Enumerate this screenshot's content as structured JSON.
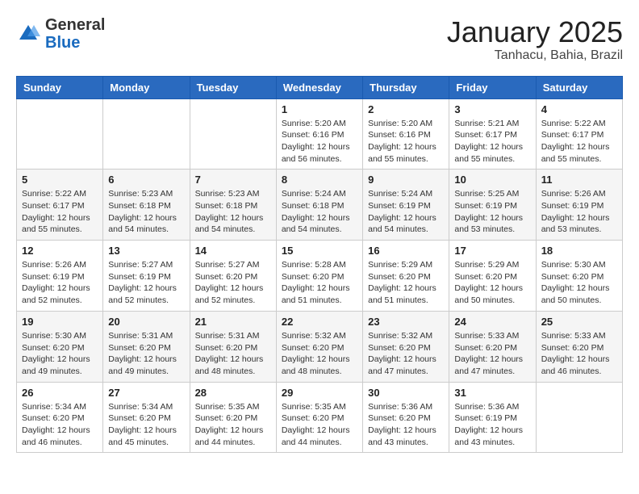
{
  "logo": {
    "general": "General",
    "blue": "Blue"
  },
  "header": {
    "month": "January 2025",
    "location": "Tanhacu, Bahia, Brazil"
  },
  "weekdays": [
    "Sunday",
    "Monday",
    "Tuesday",
    "Wednesday",
    "Thursday",
    "Friday",
    "Saturday"
  ],
  "weeks": [
    [
      {
        "day": "",
        "info": ""
      },
      {
        "day": "",
        "info": ""
      },
      {
        "day": "",
        "info": ""
      },
      {
        "day": "1",
        "info": "Sunrise: 5:20 AM\nSunset: 6:16 PM\nDaylight: 12 hours and 56 minutes."
      },
      {
        "day": "2",
        "info": "Sunrise: 5:20 AM\nSunset: 6:16 PM\nDaylight: 12 hours and 55 minutes."
      },
      {
        "day": "3",
        "info": "Sunrise: 5:21 AM\nSunset: 6:17 PM\nDaylight: 12 hours and 55 minutes."
      },
      {
        "day": "4",
        "info": "Sunrise: 5:22 AM\nSunset: 6:17 PM\nDaylight: 12 hours and 55 minutes."
      }
    ],
    [
      {
        "day": "5",
        "info": "Sunrise: 5:22 AM\nSunset: 6:17 PM\nDaylight: 12 hours and 55 minutes."
      },
      {
        "day": "6",
        "info": "Sunrise: 5:23 AM\nSunset: 6:18 PM\nDaylight: 12 hours and 54 minutes."
      },
      {
        "day": "7",
        "info": "Sunrise: 5:23 AM\nSunset: 6:18 PM\nDaylight: 12 hours and 54 minutes."
      },
      {
        "day": "8",
        "info": "Sunrise: 5:24 AM\nSunset: 6:18 PM\nDaylight: 12 hours and 54 minutes."
      },
      {
        "day": "9",
        "info": "Sunrise: 5:24 AM\nSunset: 6:19 PM\nDaylight: 12 hours and 54 minutes."
      },
      {
        "day": "10",
        "info": "Sunrise: 5:25 AM\nSunset: 6:19 PM\nDaylight: 12 hours and 53 minutes."
      },
      {
        "day": "11",
        "info": "Sunrise: 5:26 AM\nSunset: 6:19 PM\nDaylight: 12 hours and 53 minutes."
      }
    ],
    [
      {
        "day": "12",
        "info": "Sunrise: 5:26 AM\nSunset: 6:19 PM\nDaylight: 12 hours and 52 minutes."
      },
      {
        "day": "13",
        "info": "Sunrise: 5:27 AM\nSunset: 6:19 PM\nDaylight: 12 hours and 52 minutes."
      },
      {
        "day": "14",
        "info": "Sunrise: 5:27 AM\nSunset: 6:20 PM\nDaylight: 12 hours and 52 minutes."
      },
      {
        "day": "15",
        "info": "Sunrise: 5:28 AM\nSunset: 6:20 PM\nDaylight: 12 hours and 51 minutes."
      },
      {
        "day": "16",
        "info": "Sunrise: 5:29 AM\nSunset: 6:20 PM\nDaylight: 12 hours and 51 minutes."
      },
      {
        "day": "17",
        "info": "Sunrise: 5:29 AM\nSunset: 6:20 PM\nDaylight: 12 hours and 50 minutes."
      },
      {
        "day": "18",
        "info": "Sunrise: 5:30 AM\nSunset: 6:20 PM\nDaylight: 12 hours and 50 minutes."
      }
    ],
    [
      {
        "day": "19",
        "info": "Sunrise: 5:30 AM\nSunset: 6:20 PM\nDaylight: 12 hours and 49 minutes."
      },
      {
        "day": "20",
        "info": "Sunrise: 5:31 AM\nSunset: 6:20 PM\nDaylight: 12 hours and 49 minutes."
      },
      {
        "day": "21",
        "info": "Sunrise: 5:31 AM\nSunset: 6:20 PM\nDaylight: 12 hours and 48 minutes."
      },
      {
        "day": "22",
        "info": "Sunrise: 5:32 AM\nSunset: 6:20 PM\nDaylight: 12 hours and 48 minutes."
      },
      {
        "day": "23",
        "info": "Sunrise: 5:32 AM\nSunset: 6:20 PM\nDaylight: 12 hours and 47 minutes."
      },
      {
        "day": "24",
        "info": "Sunrise: 5:33 AM\nSunset: 6:20 PM\nDaylight: 12 hours and 47 minutes."
      },
      {
        "day": "25",
        "info": "Sunrise: 5:33 AM\nSunset: 6:20 PM\nDaylight: 12 hours and 46 minutes."
      }
    ],
    [
      {
        "day": "26",
        "info": "Sunrise: 5:34 AM\nSunset: 6:20 PM\nDaylight: 12 hours and 46 minutes."
      },
      {
        "day": "27",
        "info": "Sunrise: 5:34 AM\nSunset: 6:20 PM\nDaylight: 12 hours and 45 minutes."
      },
      {
        "day": "28",
        "info": "Sunrise: 5:35 AM\nSunset: 6:20 PM\nDaylight: 12 hours and 44 minutes."
      },
      {
        "day": "29",
        "info": "Sunrise: 5:35 AM\nSunset: 6:20 PM\nDaylight: 12 hours and 44 minutes."
      },
      {
        "day": "30",
        "info": "Sunrise: 5:36 AM\nSunset: 6:20 PM\nDaylight: 12 hours and 43 minutes."
      },
      {
        "day": "31",
        "info": "Sunrise: 5:36 AM\nSunset: 6:19 PM\nDaylight: 12 hours and 43 minutes."
      },
      {
        "day": "",
        "info": ""
      }
    ]
  ]
}
